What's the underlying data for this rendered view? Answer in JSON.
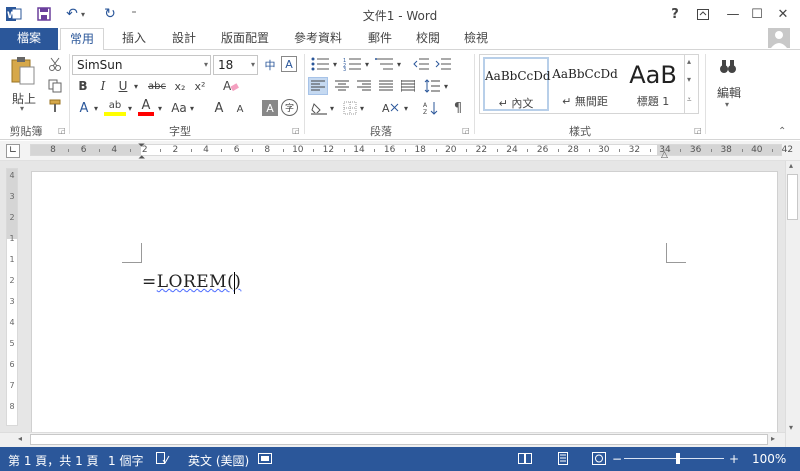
{
  "window": {
    "title": "文件1 - Word",
    "help": "?",
    "minimize": "—",
    "restore": "☐",
    "close": "✕"
  },
  "qat": {
    "undo": "↶",
    "redo": "↻",
    "customize": "⁼"
  },
  "tabs": [
    {
      "label": "檔案"
    },
    {
      "label": "常用"
    },
    {
      "label": "插入"
    },
    {
      "label": "設計"
    },
    {
      "label": "版面配置"
    },
    {
      "label": "參考資料"
    },
    {
      "label": "郵件"
    },
    {
      "label": "校閱"
    },
    {
      "label": "檢視"
    }
  ],
  "clipboard": {
    "paste_label": "貼上",
    "group_label": "剪貼簿"
  },
  "font": {
    "font_name": "SimSun",
    "font_size": "18",
    "bold": "B",
    "italic": "I",
    "underline": "U",
    "strike": "abc",
    "subscript": "x₂",
    "superscript": "x²",
    "text_effects": "A",
    "highlight": "ab",
    "font_color": "A",
    "change_case": "Aa",
    "grow": "A",
    "shrink": "A",
    "char_shading": "A",
    "enclose": "字",
    "wen": "中",
    "box": "A",
    "group_label": "字型"
  },
  "paragraph": {
    "group_label": "段落"
  },
  "styles": {
    "items": [
      {
        "sample": "AaBbCcDd",
        "name": "↵ 內文"
      },
      {
        "sample": "AaBbCcDd",
        "name": "↵ 無間距"
      },
      {
        "sample": "AaB",
        "name": "標題 1"
      }
    ],
    "group_label": "樣式"
  },
  "editing": {
    "label": "編輯"
  },
  "ruler": {
    "numbers": [
      "8",
      "6",
      "4",
      "2",
      "2",
      "4",
      "6",
      "8",
      "10",
      "12",
      "14",
      "16",
      "18",
      "20",
      "22",
      "24",
      "26",
      "28",
      "30",
      "32",
      "34",
      "36",
      "38",
      "40",
      "42"
    ],
    "vnumbers": [
      "4",
      "3",
      "2",
      "1",
      "1",
      "2",
      "3",
      "4",
      "5",
      "6",
      "7",
      "8"
    ]
  },
  "document": {
    "prefix": "=",
    "text": "LOREM()"
  },
  "status": {
    "page": "第 1 頁，共 1 頁",
    "words": "1 個字",
    "language": "英文 (美國)",
    "zoom": "100%",
    "zoom_minus": "−",
    "zoom_plus": "+"
  },
  "colors": {
    "accent": "#2b579a",
    "highlight_yellow": "#ffff00",
    "font_red": "#ff0000"
  }
}
